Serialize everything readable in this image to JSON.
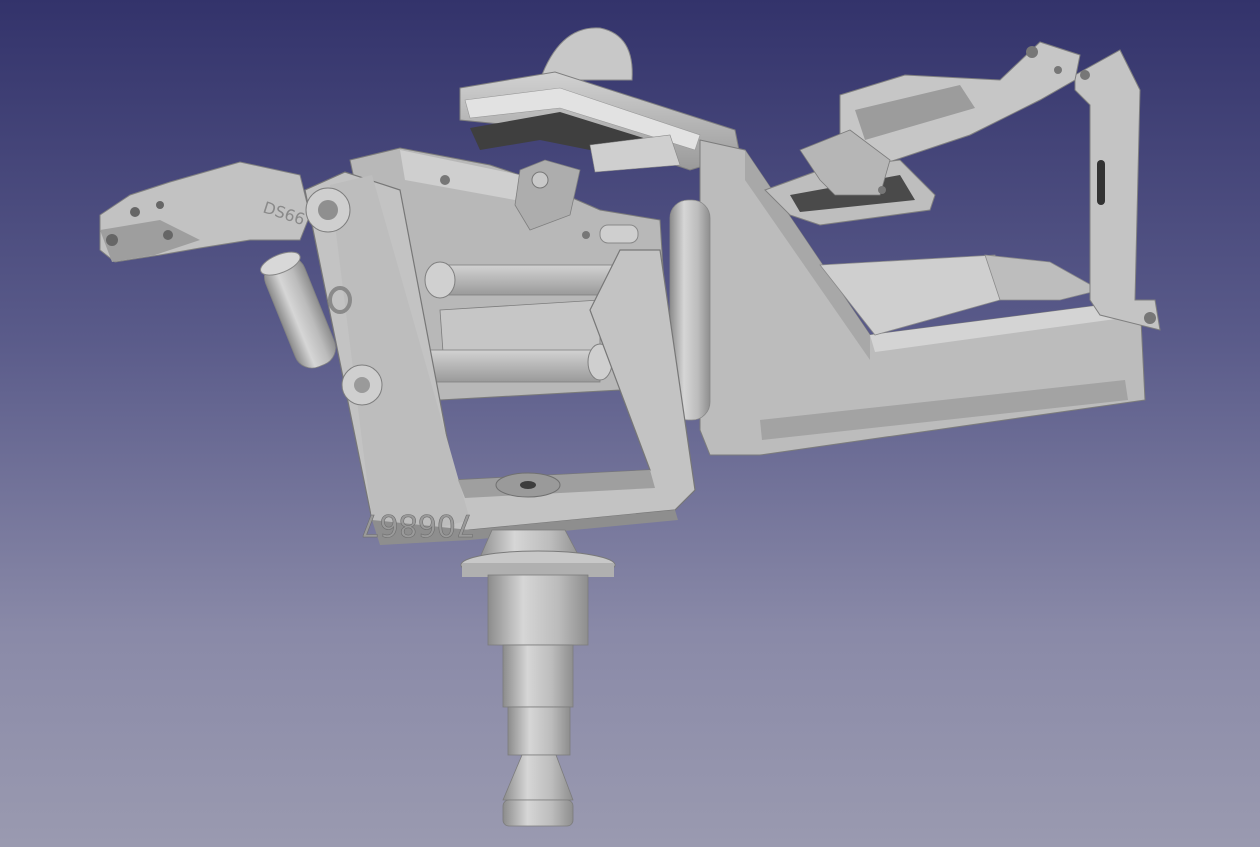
{
  "viewer": {
    "background_top": "#33336b",
    "background_bottom": "#9a9ab0",
    "model_color": "#bdbdbd"
  },
  "model": {
    "engraved_number": "706867",
    "side_marking": "DS66"
  }
}
